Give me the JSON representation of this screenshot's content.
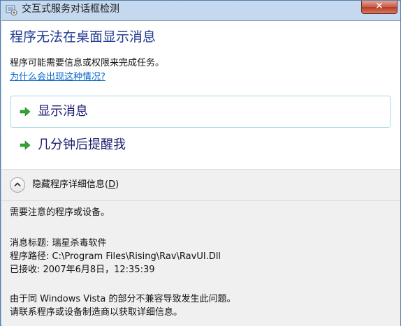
{
  "window": {
    "title": "交互式服务对话框检测",
    "close_label": "✕"
  },
  "main": {
    "heading": "程序无法在桌面显示消息",
    "description": "程序可能需要信息或权限来完成任务。",
    "help_link": "为什么会出现这种情况?",
    "commands": [
      {
        "label": "显示消息",
        "icon": "green-arrow-icon",
        "selected": true
      },
      {
        "label": "几分钟后提醒我",
        "icon": "green-arrow-icon",
        "selected": false
      }
    ]
  },
  "details_toggle": {
    "label": "隐藏程序详细信息(",
    "hotkey": "D",
    "label_end": ")",
    "icon": "chevron-up-icon"
  },
  "details": {
    "intro": "需要注意的程序或设备。",
    "message_title": "消息标题: 瑞星杀毒软件",
    "program_path": "程序路径: C:\\Program Files\\Rising\\Rav\\RavUI.Dll",
    "received": "已接收: 2007年6月8日，12:35:39",
    "cause": "由于同 Windows Vista 的部分不兼容导致发生此问题。",
    "contact": "请联系程序或设备制造商以获取详细信息。"
  },
  "colors": {
    "heading": "#1f3a93",
    "link": "#0066cc",
    "arrow": "#2fa82f",
    "selected_border": "#a6d9e8"
  }
}
